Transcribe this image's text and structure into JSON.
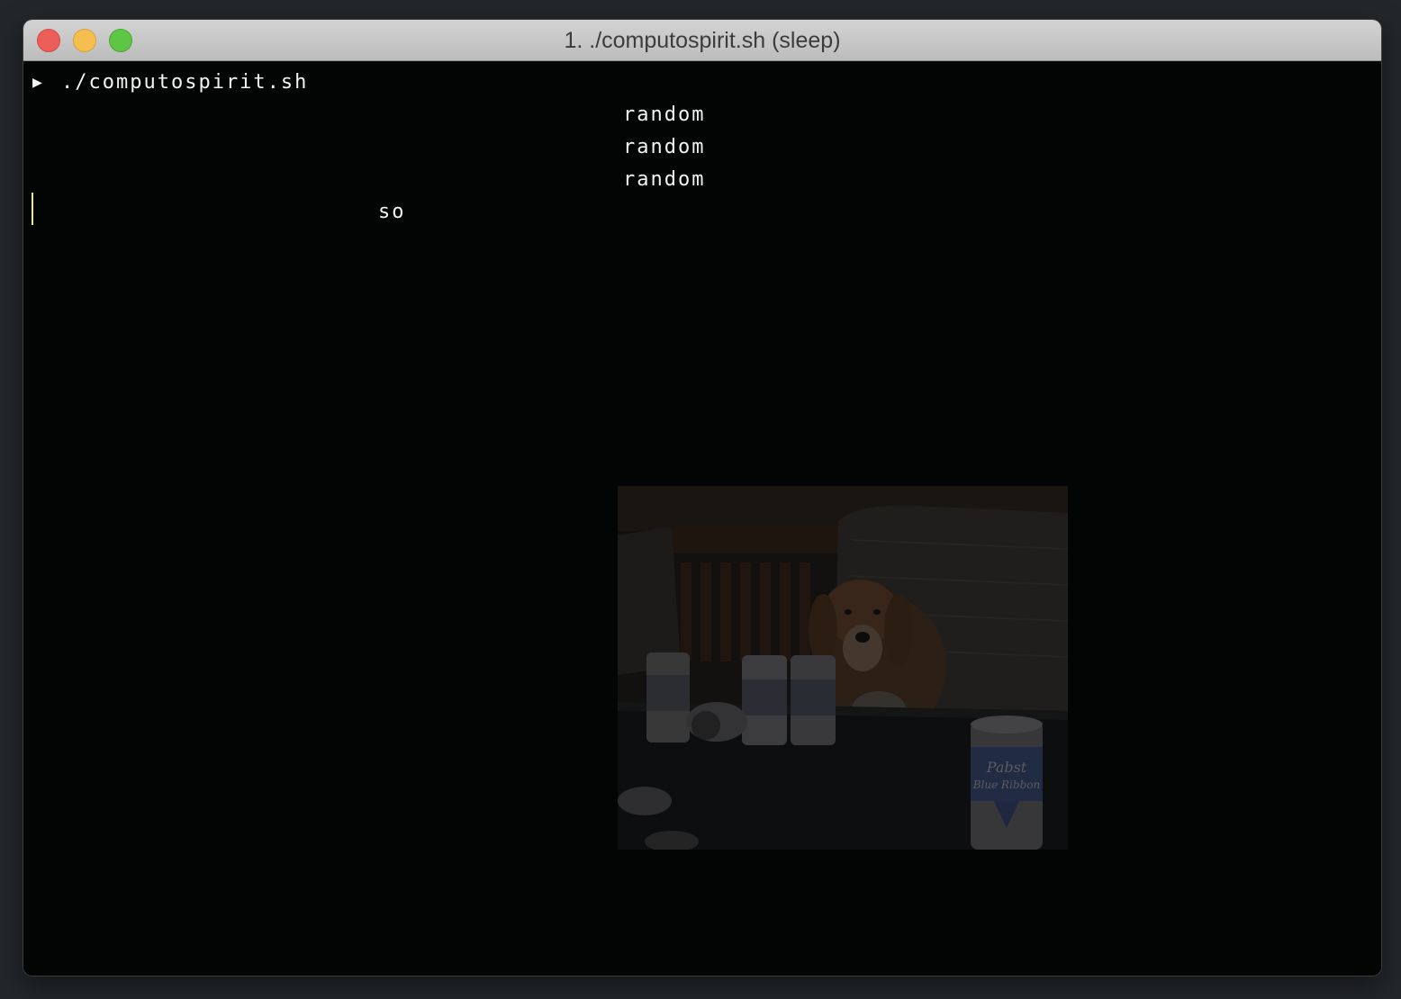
{
  "window": {
    "title": "1. ./computospirit.sh (sleep)",
    "colors": {
      "close": "#ec5f58",
      "minimize": "#f6be4f",
      "maximize": "#5ec546",
      "terminal_bg": "#030404",
      "text": "#f2f2f2",
      "cursor": "#f1f160"
    }
  },
  "terminal": {
    "prompt_icon": "play-arrow-icon",
    "prompt_glyph": "▶",
    "command": "./computospirit.sh",
    "output_lines": [
      "random",
      "random",
      "random"
    ],
    "output_word": "so"
  },
  "image": {
    "cans": [
      "Pabst",
      "Blue Ribbon"
    ]
  }
}
